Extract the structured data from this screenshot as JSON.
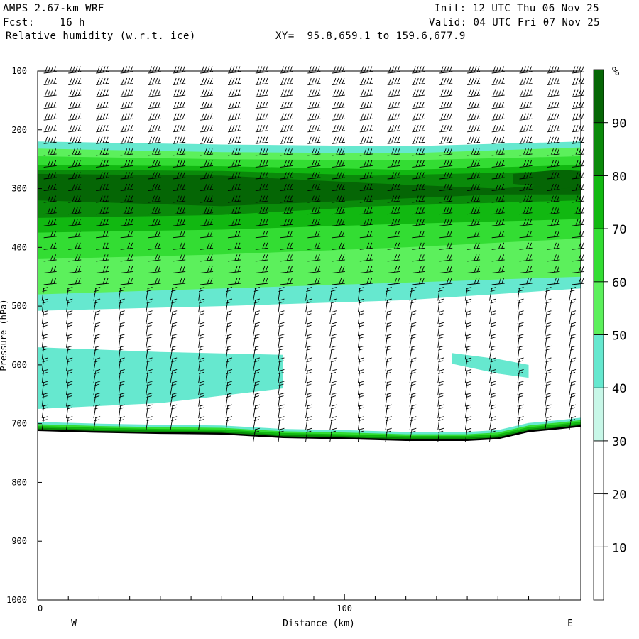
{
  "header": {
    "model": "AMPS 2.67-km WRF",
    "forecast": "Fcst:    16 h",
    "field": "Relative humidity (w.r.t. ice)",
    "xy": "XY=  95.8,659.1 to 159.6,677.9",
    "init": "Init: 12 UTC Thu 06 Nov 25",
    "valid": "Valid: 04 UTC Fri 07 Nov 25"
  },
  "chart_data": {
    "type": "heatmap",
    "title": "Relative humidity (w.r.t. ice)",
    "xlabel": "Distance (km)",
    "ylabel": "Pressure (hPa)",
    "x_range": [
      0,
      177
    ],
    "y_range": [
      100,
      1000
    ],
    "x_ticks": [
      0,
      100
    ],
    "x_tick_labels": [
      "0",
      "100"
    ],
    "x_end_labels": {
      "left": "W",
      "right": "E"
    },
    "y_ticks": [
      100,
      200,
      300,
      400,
      500,
      600,
      700,
      800,
      900,
      1000
    ],
    "colorbar": {
      "unit": "%",
      "levels": [
        10,
        20,
        30,
        40,
        50,
        60,
        70,
        80,
        90
      ],
      "colors": [
        "#ffffff",
        "#ffffff",
        "#ffffff",
        "#c8f7e8",
        "#66e8cf",
        "#5cf05c",
        "#33dd33",
        "#11b811",
        "#0a8a0a",
        "#056605"
      ]
    },
    "terrain_pressure": [
      {
        "x": 0,
        "p": 711
      },
      {
        "x": 20,
        "p": 714
      },
      {
        "x": 40,
        "p": 716
      },
      {
        "x": 60,
        "p": 717
      },
      {
        "x": 80,
        "p": 723
      },
      {
        "x": 100,
        "p": 725
      },
      {
        "x": 120,
        "p": 728
      },
      {
        "x": 140,
        "p": 728
      },
      {
        "x": 150,
        "p": 725
      },
      {
        "x": 160,
        "p": 713
      },
      {
        "x": 170,
        "p": 708
      },
      {
        "x": 177,
        "p": 704
      }
    ],
    "rh_bands": [
      {
        "level": 40,
        "top": [
          [
            0,
            220
          ],
          [
            60,
            225
          ],
          [
            120,
            228
          ],
          [
            177,
            220
          ]
        ],
        "bottom": [
          [
            0,
            508
          ],
          [
            60,
            500
          ],
          [
            120,
            490
          ],
          [
            177,
            470
          ]
        ]
      },
      {
        "level": 50,
        "top": [
          [
            0,
            232
          ],
          [
            60,
            238
          ],
          [
            120,
            240
          ],
          [
            177,
            230
          ]
        ],
        "bottom": [
          [
            0,
            480
          ],
          [
            60,
            470
          ],
          [
            120,
            460
          ],
          [
            177,
            450
          ]
        ]
      },
      {
        "level": 60,
        "top": [
          [
            0,
            245
          ],
          [
            60,
            250
          ],
          [
            120,
            252
          ],
          [
            177,
            245
          ]
        ],
        "bottom": [
          [
            0,
            420
          ],
          [
            60,
            412
          ],
          [
            120,
            400
          ],
          [
            177,
            385
          ]
        ]
      },
      {
        "level": 70,
        "top": [
          [
            0,
            260
          ],
          [
            60,
            262
          ],
          [
            120,
            268
          ],
          [
            177,
            260
          ]
        ],
        "bottom": [
          [
            0,
            375
          ],
          [
            60,
            370
          ],
          [
            120,
            360
          ],
          [
            177,
            352
          ]
        ]
      },
      {
        "level": 80,
        "top": [
          [
            0,
            268
          ],
          [
            60,
            270
          ],
          [
            110,
            278
          ],
          [
            177,
            270
          ]
        ],
        "bottom": [
          [
            0,
            350
          ],
          [
            60,
            345
          ],
          [
            110,
            330
          ],
          [
            177,
            320
          ]
        ]
      },
      {
        "level": 90,
        "top": [
          [
            0,
            275
          ],
          [
            60,
            278
          ],
          [
            105,
            290
          ],
          [
            150,
            300
          ],
          [
            177,
            290
          ]
        ],
        "bottom": [
          [
            0,
            320
          ],
          [
            60,
            330
          ],
          [
            105,
            320
          ],
          [
            150,
            310
          ],
          [
            177,
            310
          ]
        ]
      }
    ],
    "rh_low_band": {
      "level": 40,
      "top": [
        [
          0,
          570
        ],
        [
          40,
          578
        ],
        [
          80,
          583
        ]
      ],
      "bottom": [
        [
          0,
          675
        ],
        [
          40,
          665
        ],
        [
          80,
          640
        ]
      ]
    },
    "rh_secondary_patches": [
      {
        "level": 40,
        "top": [
          [
            135,
            580
          ],
          [
            150,
            590
          ],
          [
            160,
            600
          ]
        ],
        "bottom": [
          [
            135,
            598
          ],
          [
            150,
            615
          ],
          [
            160,
            622
          ]
        ]
      }
    ],
    "rh_upper_right": {
      "level": 90,
      "top": [
        [
          155,
          275
        ],
        [
          170,
          268
        ],
        [
          177,
          270
        ]
      ],
      "bottom": [
        [
          155,
          292
        ],
        [
          170,
          300
        ],
        [
          177,
          298
        ]
      ]
    },
    "wind_barb_columns_x": [
      2,
      10,
      19,
      27,
      36,
      44,
      53,
      62,
      71,
      79,
      88,
      96,
      105,
      114,
      122,
      131,
      140,
      148,
      157,
      166,
      174
    ],
    "wind_barb_levels_hpa": [
      100,
      120,
      140,
      160,
      180,
      200,
      220,
      240,
      260,
      280,
      300,
      320,
      340,
      360,
      380,
      400,
      420,
      440,
      460,
      480,
      500,
      520,
      540,
      560,
      580,
      600,
      620,
      640,
      660,
      680,
      700,
      720
    ]
  }
}
